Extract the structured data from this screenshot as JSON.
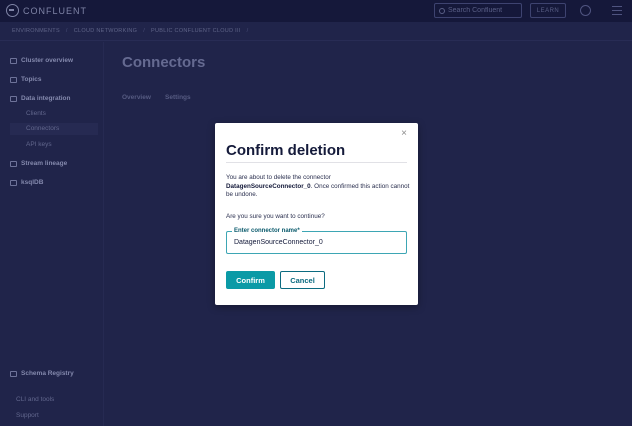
{
  "app": {
    "logo_text": "CONFLUENT"
  },
  "topbar": {
    "search_placeholder": "Search Confluent",
    "learn_label": "LEARN"
  },
  "breadcrumb": {
    "items": [
      "ENVIRONMENTS",
      "CLOUD NETWORKING",
      "PUBLIC CONFLUENT CLOUD III"
    ],
    "separator": "/"
  },
  "sidebar": {
    "items": [
      {
        "label": "Cluster overview",
        "icon": "dashboard-icon"
      },
      {
        "label": "Topics",
        "icon": "topics-icon"
      },
      {
        "label": "Data integration",
        "icon": "integration-icon"
      },
      {
        "label": "Stream lineage",
        "icon": "lineage-icon"
      },
      {
        "label": "ksqlDB",
        "icon": "ksqldb-icon"
      },
      {
        "label": "Schema Registry",
        "icon": "schema-icon"
      }
    ],
    "sub_items": [
      "Clients",
      "Connectors",
      "API keys"
    ],
    "footer_items": [
      "CLI and tools",
      "Support"
    ]
  },
  "main": {
    "title": "Connectors",
    "tabs": [
      "Overview",
      "Settings"
    ]
  },
  "modal": {
    "title": "Confirm deletion",
    "body_prefix": "You are about to delete the connector",
    "connector_name": "DatagenSourceConnector_0",
    "body_suffix": ". Once confirmed this action cannot be undone.",
    "question": "Are you sure you want to continue?",
    "field_label": "Enter connector name*",
    "field_value": "DatagenSourceConnector_0",
    "confirm_label": "Confirm",
    "cancel_label": "Cancel",
    "close_glyph": "×"
  },
  "colors": {
    "accent": "#0b9aa6",
    "overlay": "#20244a",
    "modal_bg": "#ffffff"
  }
}
